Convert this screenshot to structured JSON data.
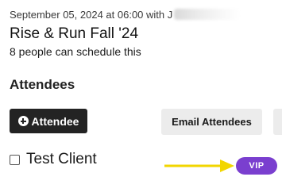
{
  "event": {
    "meta_text": "September 05, 2024 at 06:00 with J",
    "title": "Rise & Run Fall '24",
    "capacity_text": "8 people can schedule this"
  },
  "attendees": {
    "heading": "Attendees",
    "add_button_label": "Attendee",
    "email_button_label": "Email Attendees",
    "list": [
      {
        "name": "Test Client",
        "badge": "VIP"
      }
    ]
  },
  "colors": {
    "primary_button": "#232323",
    "vip_badge": "#7a3fcf",
    "annotation_arrow": "#f2d600"
  }
}
